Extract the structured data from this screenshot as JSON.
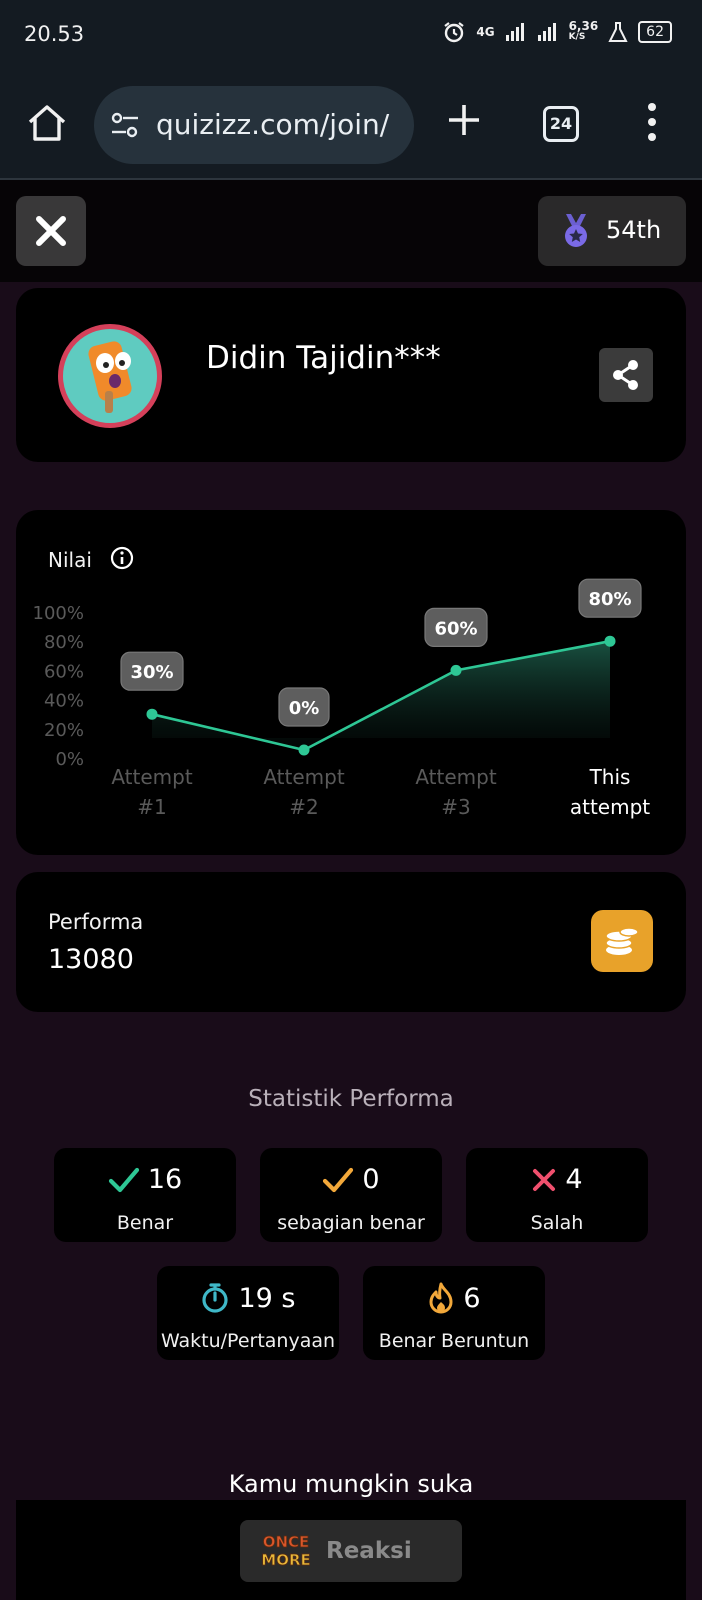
{
  "status_bar": {
    "time": "20.53",
    "network": "4G",
    "speed": "6,36",
    "speed_unit": "K/S",
    "battery": "62"
  },
  "browser": {
    "url": "quizizz.com/join/",
    "tab_count": "24"
  },
  "header": {
    "rank": "54th"
  },
  "profile": {
    "name": "Didin Tajidin***"
  },
  "chart_card": {
    "label": "Nilai"
  },
  "chart_data": {
    "type": "area",
    "categories": [
      "Attempt #1",
      "Attempt #2",
      "Attempt #3",
      "This attempt"
    ],
    "category_lines": [
      [
        "Attempt",
        "#1"
      ],
      [
        "Attempt",
        "#2"
      ],
      [
        "Attempt",
        "#3"
      ],
      [
        "This",
        "attempt"
      ]
    ],
    "values": [
      30,
      0,
      60,
      80
    ],
    "data_labels": [
      "30%",
      "0%",
      "60%",
      "80%"
    ],
    "ytick_labels": [
      "100%",
      "80%",
      "60%",
      "40%",
      "20%",
      "0%"
    ],
    "ylim": [
      0,
      100
    ],
    "line_color": "#2ec795",
    "highlight_last": true
  },
  "performance": {
    "label": "Performa",
    "value": "13080"
  },
  "stats": {
    "title": "Statistik Performa",
    "correct": {
      "value": "16",
      "label": "Benar",
      "color": "#2ec795"
    },
    "partial": {
      "value": "0",
      "label": "sebagian benar",
      "color": "#f2a83a"
    },
    "wrong": {
      "value": "4",
      "label": "Salah",
      "color": "#f0506e"
    },
    "time": {
      "value": "19 s",
      "label": "Waktu/Pertanyaan",
      "color": "#3fb8c8"
    },
    "streak": {
      "value": "6",
      "label": "Benar Beruntun",
      "color": "#f2a83a"
    }
  },
  "suggestions": {
    "title": "Kamu mungkin suka"
  },
  "reaction": {
    "logo_text_1": "ONCE",
    "logo_text_2": "MORE",
    "label": "Reaksi"
  }
}
